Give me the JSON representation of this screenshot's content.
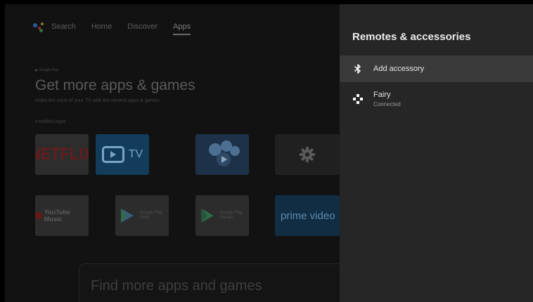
{
  "top_nav": {
    "items": [
      "Search",
      "Home",
      "Discover",
      "Apps"
    ],
    "active": "Apps"
  },
  "content": {
    "google_play_label": "Google Play",
    "headline": "Get more apps & games",
    "subtext": "Make the most of your TV with the newest apps & games",
    "section_label": "Installed Apps",
    "tiles_row1": [
      "NETFLIX",
      "TV"
    ],
    "tiles_row2": {
      "youtube_music": "YouTube Music",
      "play_store": "Google Play Store",
      "play_games": "Google Play Games",
      "prime": "prime video"
    },
    "find_more": "Find more apps and games"
  },
  "panel": {
    "title": "Remotes & accessories",
    "items": [
      {
        "label": "Add accessory",
        "icon": "bluetooth-icon"
      },
      {
        "label": "Fairy",
        "sublabel": "Connected",
        "icon": "gamepad-icon"
      }
    ]
  },
  "colors": {
    "panel_bg": "#262626",
    "highlight_bg": "#3a3a3a",
    "screen_bg": "#121212"
  }
}
